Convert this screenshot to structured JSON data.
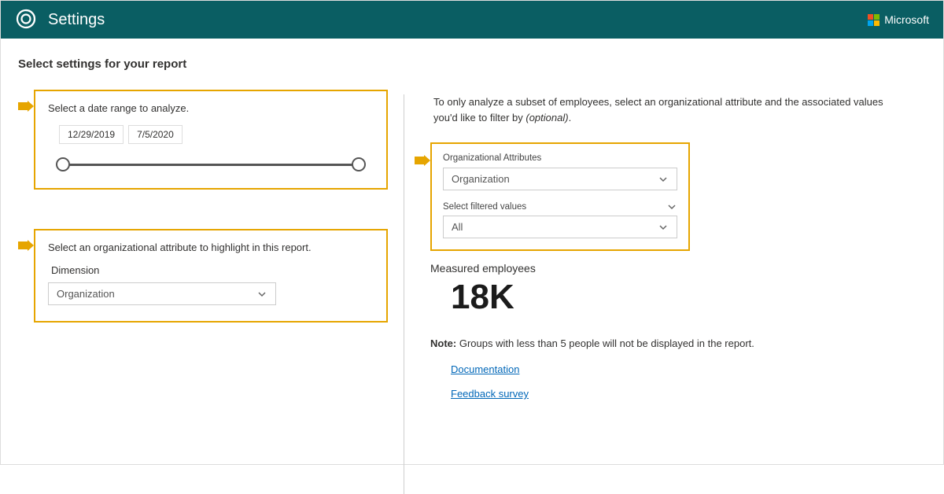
{
  "header": {
    "title": "Settings",
    "brand": "Microsoft"
  },
  "page": {
    "section_title": "Select settings for your report"
  },
  "date_range": {
    "label": "Select a date range to analyze.",
    "start": "12/29/2019",
    "end": "7/5/2020"
  },
  "attribute_highlight": {
    "label": "Select an organizational attribute to highlight in this report.",
    "field_label": "Dimension",
    "selected": "Organization"
  },
  "filter": {
    "intro_prefix": "To only analyze a subset of employees, select an organizational attribute and the associated values you'd like to filter by ",
    "intro_optional": "(optional)",
    "intro_suffix": ".",
    "org_attr_label": "Organizational Attributes",
    "org_attr_selected": "Organization",
    "filtered_values_label": "Select filtered values",
    "filtered_values_selected": "All"
  },
  "metric": {
    "label": "Measured employees",
    "value": "18K"
  },
  "note": {
    "prefix": "Note:",
    "text": " Groups with less than 5 people will not be displayed in the report."
  },
  "links": {
    "documentation": "Documentation",
    "feedback": "Feedback survey"
  }
}
